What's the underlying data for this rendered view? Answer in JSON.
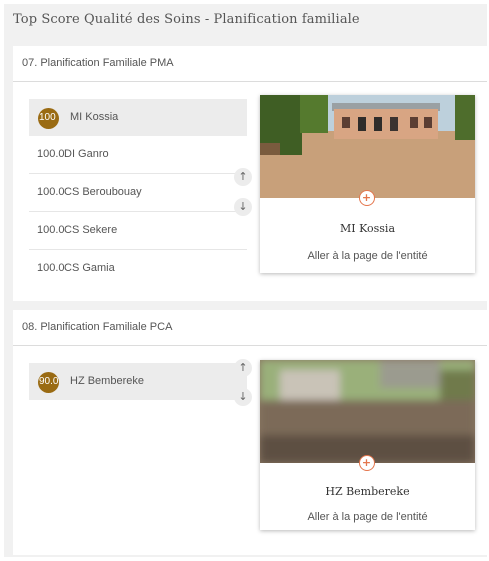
{
  "page": {
    "title": "Top Score Qualité des Soins - Planification familiale"
  },
  "sections": [
    {
      "title": "07. Planification Familiale PMA",
      "rows": [
        {
          "score": "100",
          "name": "MI Kossia"
        },
        {
          "score": "100.0",
          "name": "DI Ganro"
        },
        {
          "score": "100.0",
          "name": "CS Beroubouay"
        },
        {
          "score": "100.0",
          "name": "CS Sekere"
        },
        {
          "score": "100.0",
          "name": "CS Gamia"
        }
      ],
      "card": {
        "name": "MI Kossia",
        "link": "Aller à la page de l'entité"
      }
    },
    {
      "title": "08. Planification Familiale PCA",
      "rows": [
        {
          "score": "90.0",
          "name": "HZ Bembereke"
        }
      ],
      "card": {
        "name": "HZ Bembereke",
        "link": "Aller à la page de l'entité"
      }
    }
  ],
  "controls": {
    "up": "↑",
    "down": "↓",
    "pin": "+"
  },
  "colors": {
    "badge": "#9a6b13",
    "pin": "#e4764d"
  },
  "icons": {
    "up": "arrow-up-icon",
    "down": "arrow-down-icon",
    "pin": "map-pin-icon"
  }
}
